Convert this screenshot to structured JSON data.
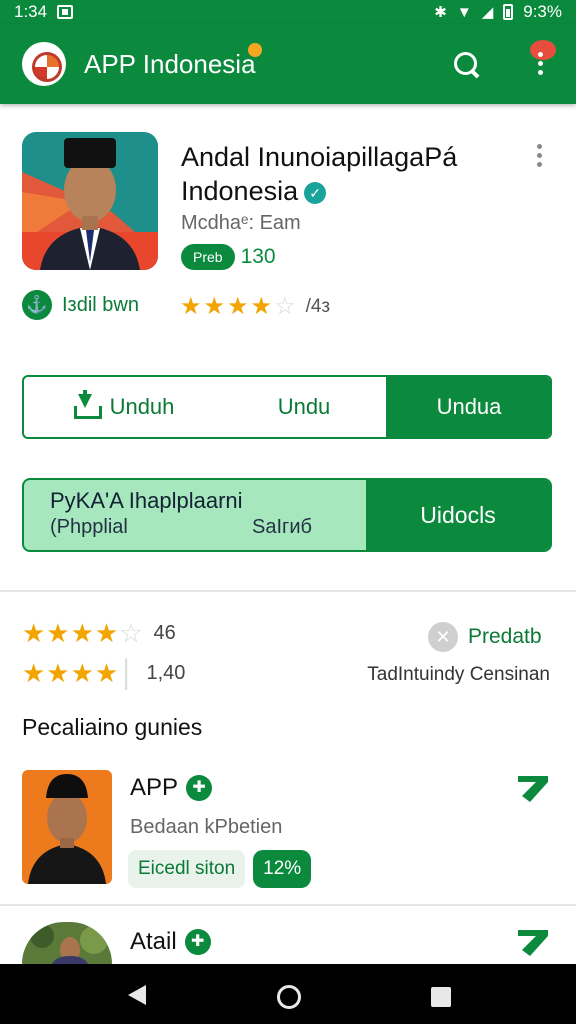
{
  "status_bar": {
    "time": "1:34",
    "battery": "9:3%"
  },
  "app_bar": {
    "title": "APP Indonesia"
  },
  "app": {
    "title_line1": "Andal InunoiapillagaPá",
    "title_line2": "Indonesia",
    "subtitle": "Mcdhaᵉ: Eam",
    "badge": "Prеb",
    "badge_count": "130",
    "download_label": "Iзdil bᴡn",
    "rating_value": "/4з",
    "rating_stars": 3.5
  },
  "buttons": {
    "primary": "Unduh",
    "secondary": "Undu",
    "tertiary": "Undua"
  },
  "promo": {
    "line1": "PyKA'A Ihaplplaarni",
    "line2": "(Phpplial",
    "line3": "SaIгиб",
    "cta": "Uidocls"
  },
  "ratings": {
    "row1_value": "46",
    "row1_stars": 4.5,
    "row2_value": "1,40",
    "row2_stars": 4,
    "predicted_label": "Predatb",
    "tagline": "TadIntuindy Censinan"
  },
  "section": {
    "title": "Pecaliaino gunies"
  },
  "list": [
    {
      "title": "APP",
      "subtitle": "Bedaan kPbetien",
      "chip1": "Eicedl siton",
      "chip2": "12%"
    },
    {
      "title": "Atail"
    }
  ],
  "colors": {
    "brand": "#0b8a3e",
    "star": "#f2a400",
    "promo_bg": "#a7e7be"
  },
  "icons": [
    "search-icon",
    "more-icon",
    "verified-icon",
    "download-icon",
    "plus-icon",
    "arrow-icon",
    "back-icon",
    "home-icon",
    "recents-icon"
  ]
}
